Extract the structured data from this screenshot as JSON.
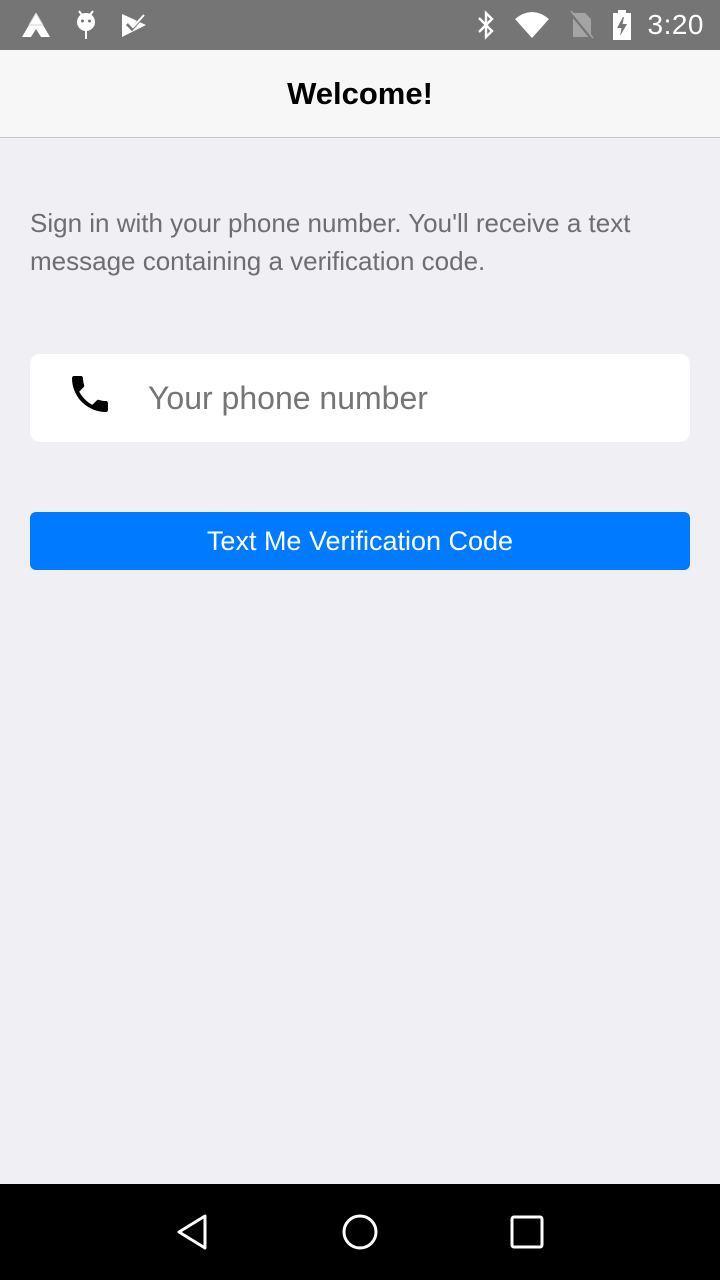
{
  "status_bar": {
    "time": "3:20",
    "left_icons": [
      "launcher-triangle-icon",
      "android-debug-icon",
      "task-check-icon"
    ],
    "right_icons": [
      "bluetooth-icon",
      "wifi-icon",
      "no-sim-icon",
      "battery-charging-icon"
    ]
  },
  "header": {
    "title": "Welcome!"
  },
  "main": {
    "intro_text": "Sign in with your phone number. You'll receive a text message containing a verification code.",
    "phone_input": {
      "placeholder": "Your phone number",
      "value": "",
      "icon": "phone-icon"
    },
    "submit_label": "Text Me Verification Code"
  },
  "nav_bar": {
    "buttons": [
      "back",
      "home",
      "recents"
    ]
  },
  "colors": {
    "accent": "#007aff",
    "background": "#efeff4",
    "header_bg": "#f7f7f7",
    "status_bar": "#757575",
    "intro_text": "#6d6d72"
  }
}
